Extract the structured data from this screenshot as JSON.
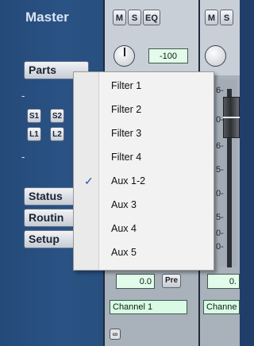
{
  "master": {
    "title": "Master",
    "buttons": {
      "parts": "Parts",
      "status": "Status",
      "routing": "Routin",
      "setup": "Setup"
    },
    "small_buttons": [
      "S1",
      "S2",
      "L1",
      "L2"
    ]
  },
  "channels": [
    {
      "buttons": [
        "M",
        "S",
        "EQ"
      ],
      "value": "-100",
      "fader_value": "0.0",
      "pre_label": "Pre",
      "name": "Channel 1"
    },
    {
      "buttons": [
        "M",
        "S"
      ],
      "fader_value": "0.",
      "name": "Channe"
    }
  ],
  "meter_ticks": [
    "6-",
    "0-",
    "6-",
    "5-",
    "0-",
    "5-",
    "0-",
    "0-"
  ],
  "left_dashes": [
    "-",
    "-"
  ],
  "link_icon": "link-icon",
  "menu": {
    "items": [
      {
        "label": "Filter 1",
        "checked": false
      },
      {
        "label": "Filter 2",
        "checked": false
      },
      {
        "label": "Filter 3",
        "checked": false
      },
      {
        "label": "Filter 4",
        "checked": false
      },
      {
        "label": "Aux 1-2",
        "checked": true
      },
      {
        "label": "Aux 3",
        "checked": false
      },
      {
        "label": "Aux 4",
        "checked": false
      },
      {
        "label": "Aux 5",
        "checked": false
      }
    ],
    "check_glyph": "✓"
  }
}
